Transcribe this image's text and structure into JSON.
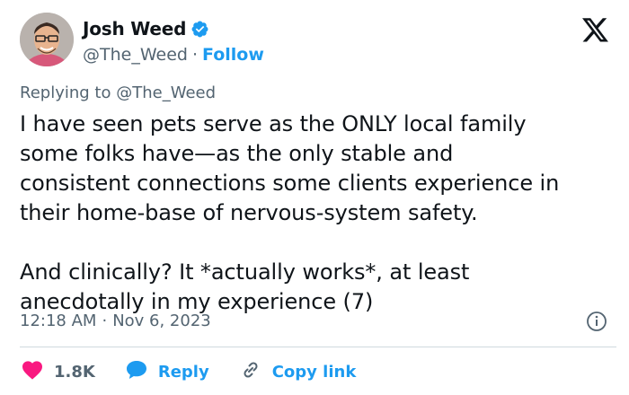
{
  "author": {
    "display_name": "Josh Weed",
    "handle": "@The_Weed",
    "separator": "·",
    "follow_label": "Follow",
    "verified_color": "#1d9bf0"
  },
  "tweet": {
    "replying_prefix": "Replying to",
    "replying_to": "@The_Weed",
    "text": "I have seen pets serve as the ONLY local family\nsome folks have—as the only stable and\nconsistent connections some clients experience in\ntheir home-base of nervous-system safety.\n\nAnd clinically? It *actually works*, at least\nanecdotally in my experience (7)",
    "time": "12:18 AM",
    "separator": "·",
    "date": "Nov 6, 2023"
  },
  "actions": {
    "likes_count": "1.8K",
    "reply_label": "Reply",
    "copy_link_label": "Copy link"
  },
  "colors": {
    "accent": "#1d9bf0",
    "heart": "#f91880",
    "muted": "#536471"
  },
  "icons": [
    "verified-badge-icon",
    "x-logo-icon",
    "info-icon",
    "heart-icon",
    "reply-bubble-icon",
    "link-icon"
  ]
}
